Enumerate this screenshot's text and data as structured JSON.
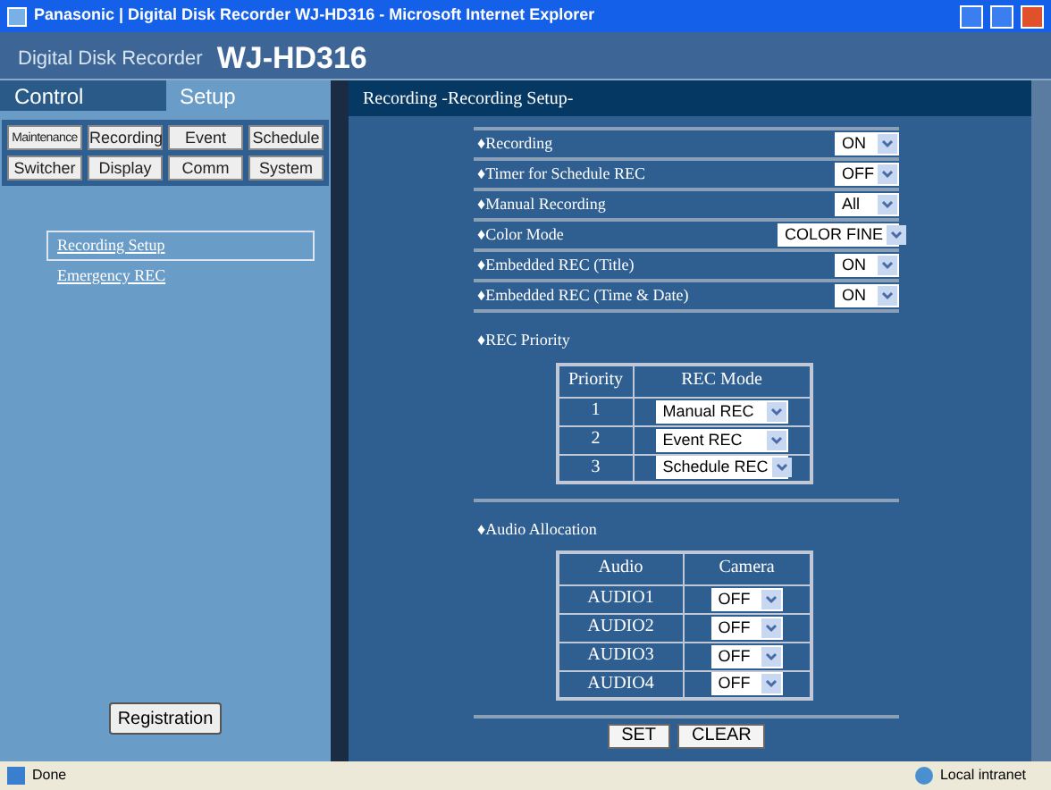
{
  "window": {
    "title": "Panasonic | Digital Disk Recorder WJ-HD316 - Microsoft Internet Explorer"
  },
  "header": {
    "brand": "Digital Disk Recorder",
    "model": "WJ-HD316"
  },
  "tabs": [
    {
      "label": "Control",
      "selected": false
    },
    {
      "label": "Setup",
      "selected": true
    }
  ],
  "menu_buttons": [
    "Maintenance",
    "Recording",
    "Event",
    "Schedule",
    "Switcher",
    "Display",
    "Comm",
    "System"
  ],
  "sidebar": {
    "items": [
      {
        "label": "Recording Setup",
        "selected": true
      },
      {
        "label": "Emergency REC",
        "selected": false
      }
    ],
    "register_button": "Registration"
  },
  "panel_title": "Recording -Recording Setup-",
  "settings": [
    {
      "label": "♦Recording",
      "value": "ON"
    },
    {
      "label": "♦Timer for Schedule REC",
      "value": "OFF"
    },
    {
      "label": "♦Manual Recording",
      "value": "All"
    },
    {
      "label": "♦Color Mode",
      "value": "COLOR FINE"
    },
    {
      "label": "♦Embedded REC (Title)",
      "value": "ON"
    },
    {
      "label": "♦Embedded REC (Time & Date)",
      "value": "ON"
    }
  ],
  "rec_priority": {
    "label": "♦REC Priority",
    "columns": [
      "Priority",
      "REC Mode"
    ],
    "rows": [
      {
        "key": "1",
        "value": "Manual REC"
      },
      {
        "key": "2",
        "value": "Event REC"
      },
      {
        "key": "3",
        "value": "Schedule REC"
      }
    ]
  },
  "audio_allocation": {
    "label": "♦Audio Allocation",
    "columns": [
      "Audio",
      "Camera"
    ],
    "rows": [
      {
        "key": "AUDIO1",
        "value": "OFF"
      },
      {
        "key": "AUDIO2",
        "value": "OFF"
      },
      {
        "key": "AUDIO3",
        "value": "OFF"
      },
      {
        "key": "AUDIO4",
        "value": "OFF"
      }
    ]
  },
  "buttons": [
    "SET",
    "CLEAR"
  ],
  "status_bar": {
    "text": "Done",
    "zone": "Local intranet"
  }
}
